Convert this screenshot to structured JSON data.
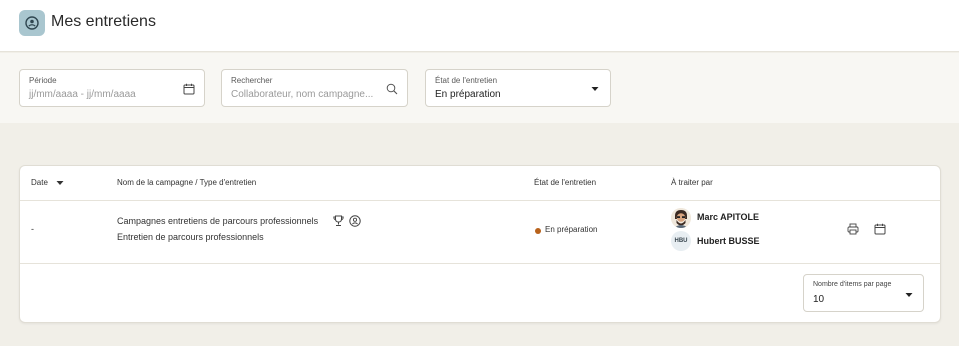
{
  "header": {
    "title": "Mes entretiens",
    "logo_icon": "interview-icon"
  },
  "filters": {
    "period": {
      "label": "Période",
      "placeholder": "jj/mm/aaaa - jj/mm/aaaa",
      "icon": "calendar-icon"
    },
    "search": {
      "label": "Rechercher",
      "placeholder": "Collaborateur, nom campagne...",
      "icon": "search-icon"
    },
    "status": {
      "label": "État de l'entretien",
      "value": "En préparation",
      "icon": "caret-down-icon"
    }
  },
  "table": {
    "columns": [
      "Date",
      "Nom de la campagne / Type d'entretien",
      "État de l'entretien",
      "À traiter par"
    ],
    "rows": [
      {
        "date": "-",
        "campaign": "Campagnes entretiens de parcours professionnels",
        "type": "Entretien  de parcours professionnels",
        "status": "En préparation",
        "status_color": "#b8621b",
        "handlers": [
          {
            "name": "Marc APITOLE",
            "avatar": "photo"
          },
          {
            "name": "Hubert BUSSE",
            "initials": "HBU"
          }
        ]
      }
    ]
  },
  "pagination": {
    "label": "Nombre d'items par page",
    "value": "10"
  },
  "colors": {
    "background": "#f1efe8",
    "logo": "#a9c6cf",
    "status_dot": "#b8621b"
  }
}
